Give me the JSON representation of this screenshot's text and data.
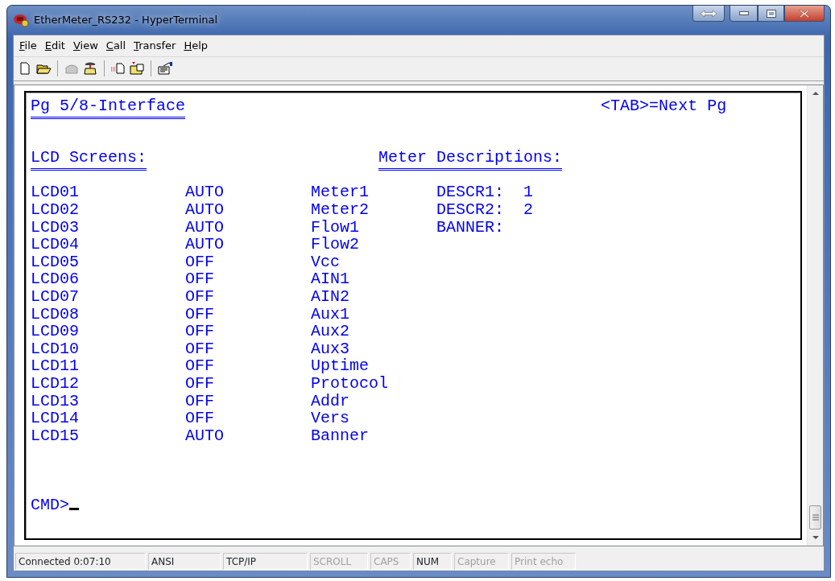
{
  "window": {
    "title": "EtherMeter_RS232 - HyperTerminal"
  },
  "menu": [
    "File",
    "Edit",
    "View",
    "Call",
    "Transfer",
    "Help"
  ],
  "terminal": {
    "page_title": "Pg 5/8-Interface",
    "hint": "<TAB>=Next Pg",
    "lcd_heading": "LCD Screens:",
    "meter_heading": "Meter Descriptions:",
    "lcd_screens": [
      {
        "id": "LCD01",
        "mode": "AUTO",
        "name": "Meter1"
      },
      {
        "id": "LCD02",
        "mode": "AUTO",
        "name": "Meter2"
      },
      {
        "id": "LCD03",
        "mode": "AUTO",
        "name": "Flow1"
      },
      {
        "id": "LCD04",
        "mode": "AUTO",
        "name": "Flow2"
      },
      {
        "id": "LCD05",
        "mode": "OFF",
        "name": "Vcc"
      },
      {
        "id": "LCD06",
        "mode": "OFF",
        "name": "AIN1"
      },
      {
        "id": "LCD07",
        "mode": "OFF",
        "name": "AIN2"
      },
      {
        "id": "LCD08",
        "mode": "OFF",
        "name": "Aux1"
      },
      {
        "id": "LCD09",
        "mode": "OFF",
        "name": "Aux2"
      },
      {
        "id": "LCD10",
        "mode": "OFF",
        "name": "Aux3"
      },
      {
        "id": "LCD11",
        "mode": "OFF",
        "name": "Uptime"
      },
      {
        "id": "LCD12",
        "mode": "OFF",
        "name": "Protocol"
      },
      {
        "id": "LCD13",
        "mode": "OFF",
        "name": "Addr"
      },
      {
        "id": "LCD14",
        "mode": "OFF",
        "name": "Vers"
      },
      {
        "id": "LCD15",
        "mode": "AUTO",
        "name": "Banner"
      }
    ],
    "meter_descriptions": [
      {
        "label": "DESCR1:",
        "value": "1"
      },
      {
        "label": "DESCR2:",
        "value": "2"
      },
      {
        "label": "BANNER:"
      }
    ],
    "prompt": "CMD>"
  },
  "status_bar": [
    {
      "text": "Connected 0:07:10",
      "disabled": false
    },
    {
      "text": "ANSI",
      "disabled": false
    },
    {
      "text": "TCP/IP",
      "disabled": false
    },
    {
      "text": "SCROLL",
      "disabled": true
    },
    {
      "text": "CAPS",
      "disabled": true
    },
    {
      "text": "NUM",
      "disabled": false
    },
    {
      "text": "Capture",
      "disabled": true
    },
    {
      "text": "Print echo",
      "disabled": true
    }
  ]
}
